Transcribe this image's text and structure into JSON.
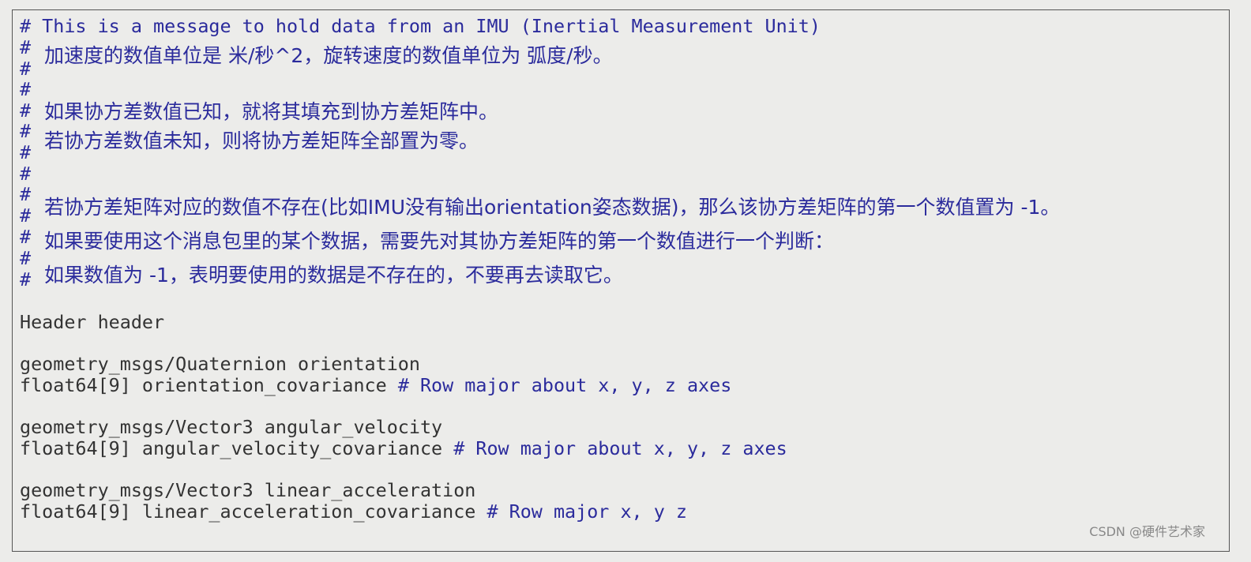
{
  "header_comment": "# This is a message to hold data from an IMU (Inertial Measurement Unit)",
  "hash": "#",
  "chinese_comments": [
    "加速度的数值单位是 米/秒^2，旋转速度的数值单位为 弧度/秒。",
    "如果协方差数值已知，就将其填充到协方差矩阵中。",
    "若协方差数值未知，则将协方差矩阵全部置为零。",
    "若协方差矩阵对应的数值不存在(比如IMU没有输出orientation姿态数据)，那么该协方差矩阵的第一个数值置为 -1。",
    "如果要使用这个消息包里的某个数据，需要先对其协方差矩阵的第一个数值进行一个判断：",
    "如果数值为 -1，表明要使用的数据是不存在的，不要再去读取它。"
  ],
  "fields": [
    {
      "code": "Header header",
      "comment": ""
    },
    {
      "code": "geometry_msgs/Quaternion orientation",
      "comment": ""
    },
    {
      "code": "float64[9] orientation_covariance ",
      "comment": "# Row major about x, y, z axes"
    },
    {
      "code": "geometry_msgs/Vector3 angular_velocity",
      "comment": ""
    },
    {
      "code": "float64[9] angular_velocity_covariance ",
      "comment": "# Row major about x, y, z axes"
    },
    {
      "code": "geometry_msgs/Vector3 linear_acceleration",
      "comment": ""
    },
    {
      "code": "float64[9] linear_acceleration_covariance ",
      "comment": "# Row major x, y z"
    }
  ],
  "watermark": "CSDN @硬件艺术家",
  "colors": {
    "comment": "#2b2b9c",
    "code": "#333333",
    "background": "#ececea"
  }
}
